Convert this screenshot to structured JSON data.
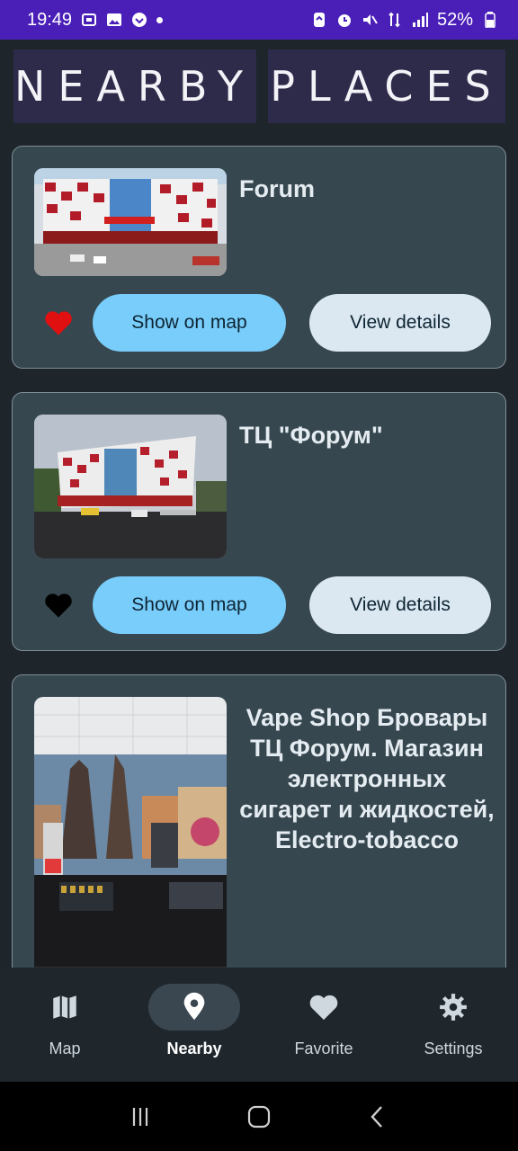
{
  "status": {
    "time": "19:49",
    "battery": "52%"
  },
  "header": {
    "word1": "NEARBY",
    "word2": "PLACES"
  },
  "places": [
    {
      "title": "Forum",
      "favorite": true,
      "show_label": "Show on map",
      "details_label": "View details"
    },
    {
      "title": "ТЦ \"Форум\"",
      "favorite": false,
      "show_label": "Show on map",
      "details_label": "View details"
    },
    {
      "title": "Vape Shop Бровары ТЦ Форум. Магазин электронных сигарет и жидкостей, Electro-tobacco"
    }
  ],
  "nav": {
    "items": [
      {
        "label": "Map",
        "icon": "map-icon"
      },
      {
        "label": "Nearby",
        "icon": "location-pin-icon",
        "active": true
      },
      {
        "label": "Favorite",
        "icon": "heart-icon"
      },
      {
        "label": "Settings",
        "icon": "gear-icon"
      }
    ]
  },
  "colors": {
    "accent": "#79cdfa",
    "favorite": "#e01010",
    "statusbar": "#4a1fb8"
  }
}
